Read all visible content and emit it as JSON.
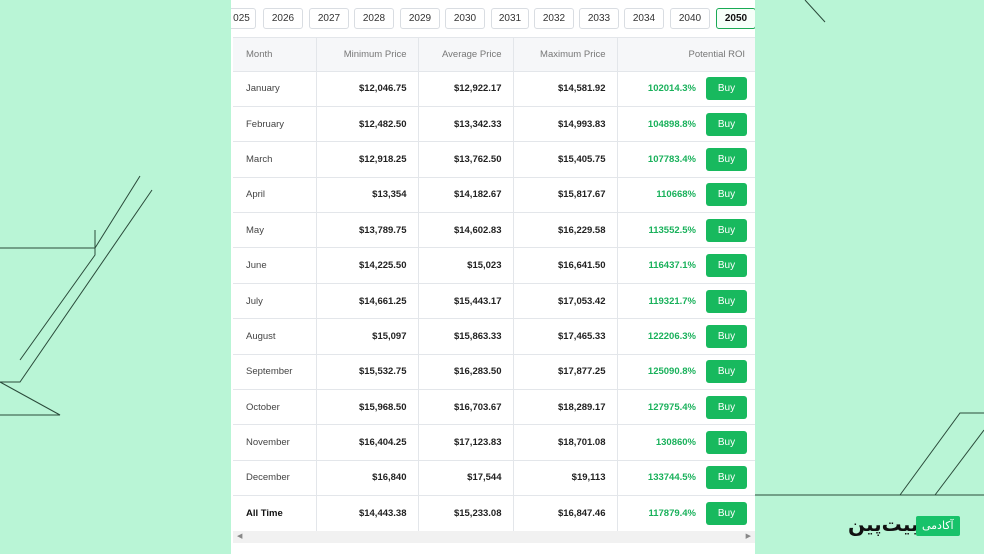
{
  "year_tabs": [
    "025",
    "2026",
    "2027",
    "2028",
    "2029",
    "2030",
    "2031",
    "2032",
    "2033",
    "2034",
    "2040",
    "2050"
  ],
  "active_year": "2050",
  "table": {
    "headers": {
      "month": "Month",
      "min": "Minimum Price",
      "avg": "Average Price",
      "max": "Maximum Price",
      "roi": "Potential ROI"
    },
    "buy_label": "Buy",
    "rows": [
      {
        "month": "January",
        "min": "$12,046.75",
        "avg": "$12,922.17",
        "max": "$14,581.92",
        "roi": "102014.3%"
      },
      {
        "month": "February",
        "min": "$12,482.50",
        "avg": "$13,342.33",
        "max": "$14,993.83",
        "roi": "104898.8%"
      },
      {
        "month": "March",
        "min": "$12,918.25",
        "avg": "$13,762.50",
        "max": "$15,405.75",
        "roi": "107783.4%"
      },
      {
        "month": "April",
        "min": "$13,354",
        "avg": "$14,182.67",
        "max": "$15,817.67",
        "roi": "110668%"
      },
      {
        "month": "May",
        "min": "$13,789.75",
        "avg": "$14,602.83",
        "max": "$16,229.58",
        "roi": "113552.5%"
      },
      {
        "month": "June",
        "min": "$14,225.50",
        "avg": "$15,023",
        "max": "$16,641.50",
        "roi": "116437.1%"
      },
      {
        "month": "July",
        "min": "$14,661.25",
        "avg": "$15,443.17",
        "max": "$17,053.42",
        "roi": "119321.7%"
      },
      {
        "month": "August",
        "min": "$15,097",
        "avg": "$15,863.33",
        "max": "$17,465.33",
        "roi": "122206.3%"
      },
      {
        "month": "September",
        "min": "$15,532.75",
        "avg": "$16,283.50",
        "max": "$17,877.25",
        "roi": "125090.8%"
      },
      {
        "month": "October",
        "min": "$15,968.50",
        "avg": "$16,703.67",
        "max": "$18,289.17",
        "roi": "127975.4%"
      },
      {
        "month": "November",
        "min": "$16,404.25",
        "avg": "$17,123.83",
        "max": "$18,701.08",
        "roi": "130860%"
      },
      {
        "month": "December",
        "min": "$16,840",
        "avg": "$17,544",
        "max": "$19,113",
        "roi": "133744.5%"
      },
      {
        "month": "All Time",
        "min": "$14,443.38",
        "avg": "$15,233.08",
        "max": "$16,847.46",
        "roi": "117879.4%"
      }
    ]
  },
  "logo": {
    "name": "بیت‌پین",
    "badge": "آکادمی"
  },
  "colors": {
    "background": "#b9f5d6",
    "accent_green": "#18b95e",
    "roi_green": "#19b15b"
  }
}
